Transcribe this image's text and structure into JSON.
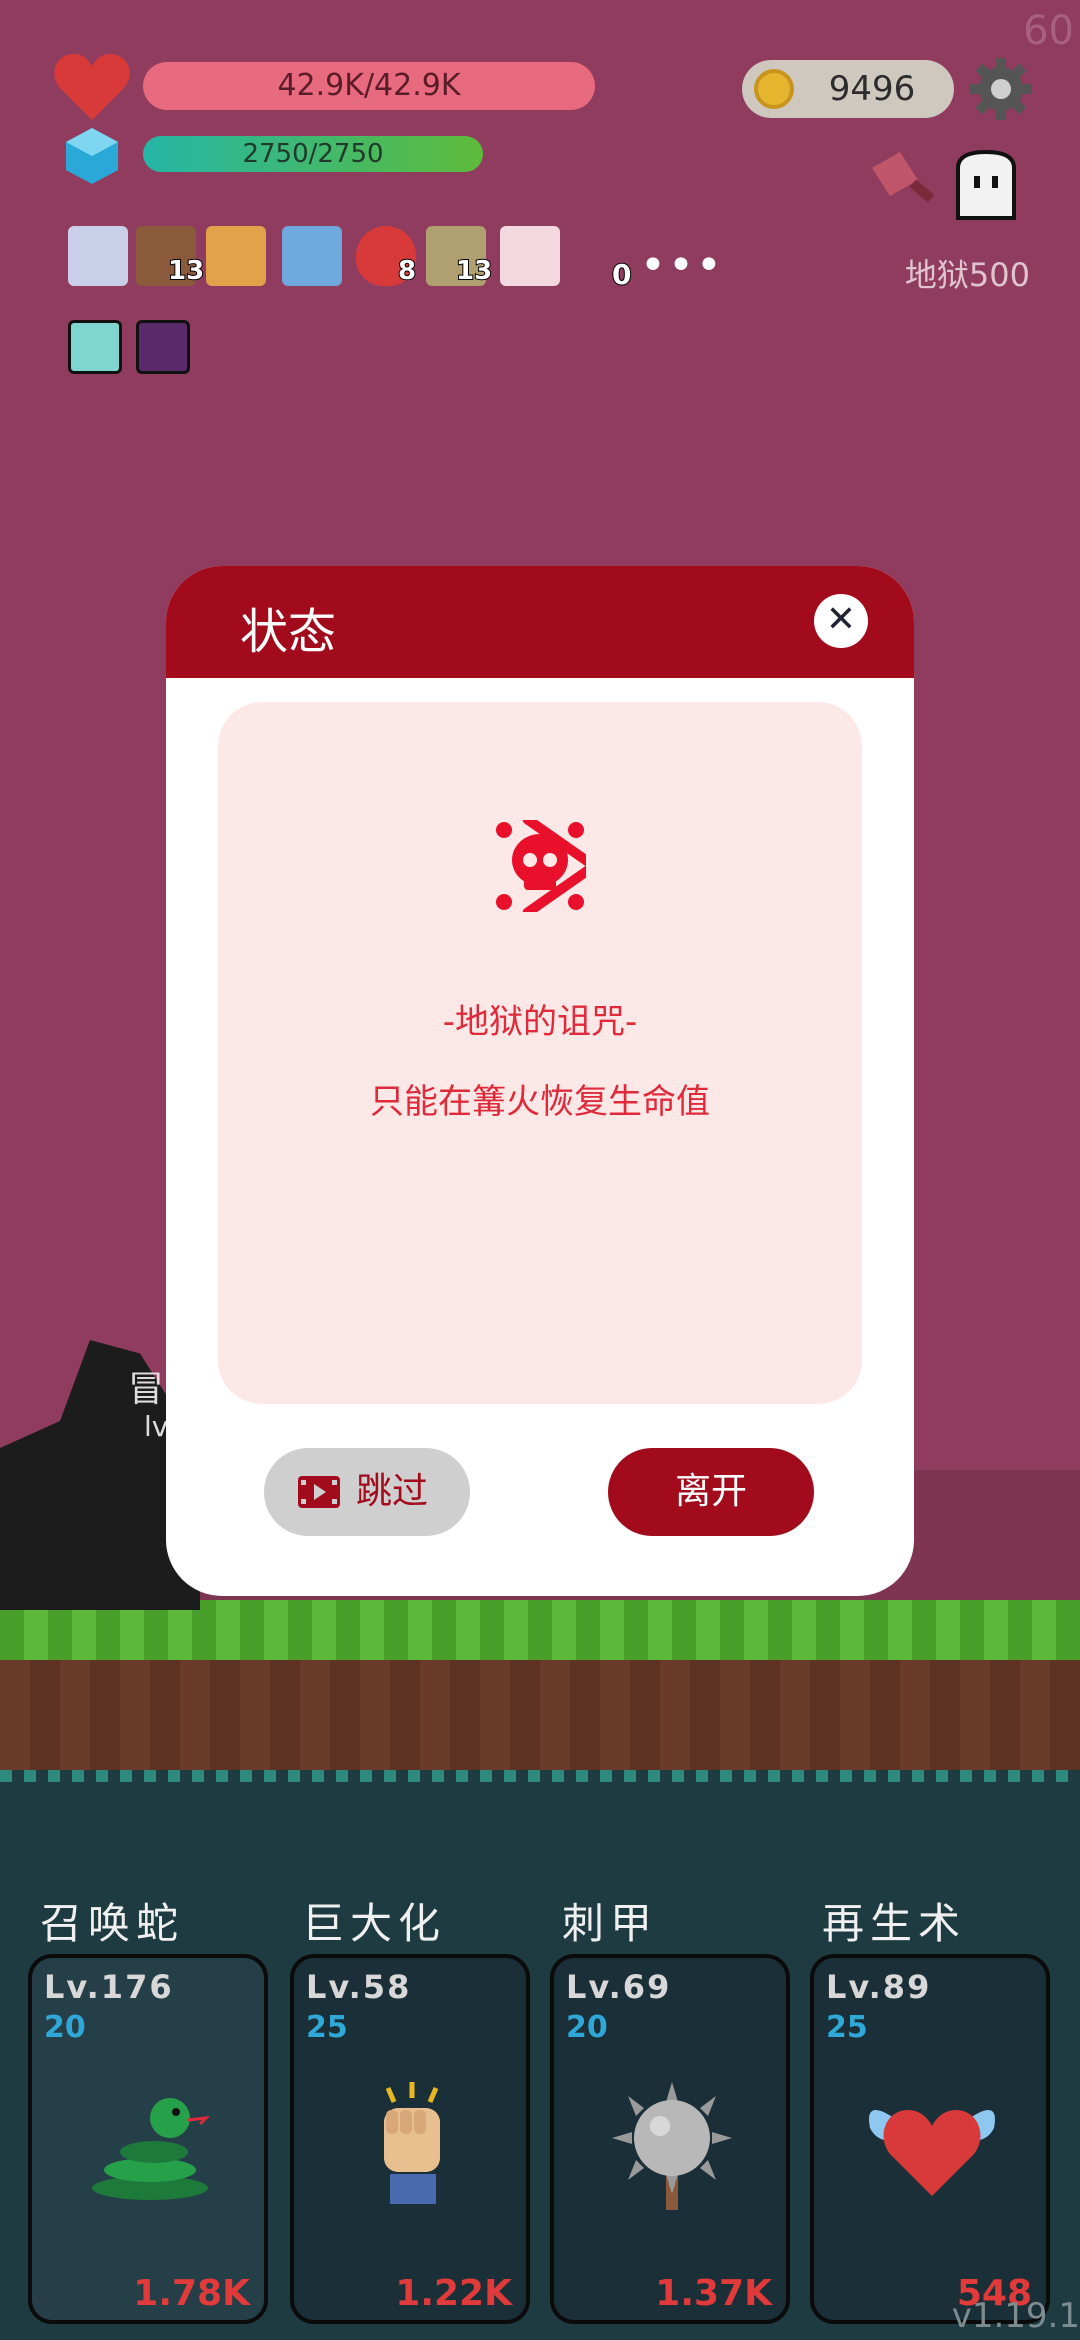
{
  "fps": "60",
  "hud": {
    "hp_text": "42.9K/42.9K",
    "mp_text": "2750/2750",
    "coins": "9496",
    "stage": "地狱500"
  },
  "items": [
    {
      "icon": "flag-badge-icon",
      "count": ""
    },
    {
      "icon": "ship-icon",
      "count": "13"
    },
    {
      "icon": "book-icon",
      "count": ""
    },
    {
      "icon": "shirt-icon",
      "count": ""
    },
    {
      "icon": "strawberry-icon",
      "count": "8"
    },
    {
      "icon": "meteor-icon",
      "count": "13"
    },
    {
      "icon": "calendar-heart-icon",
      "count": ""
    }
  ],
  "more_count": "0",
  "buffs": [
    "lightbulb-icon",
    "demon-icon"
  ],
  "background": {
    "name_fragment": "冒",
    "level_fragment": "lv"
  },
  "modal": {
    "title": "状态",
    "curse_title": "-地狱的诅咒-",
    "curse_desc": "只能在篝火恢复生命值",
    "skip_label": "跳过",
    "leave_label": "离开"
  },
  "skills": [
    {
      "name": "召唤蛇",
      "level": "Lv.176",
      "mana": "20",
      "cost": "1.78K",
      "icon": "snake-icon"
    },
    {
      "name": "巨大化",
      "level": "Lv.58",
      "mana": "25",
      "cost": "1.22K",
      "icon": "fist-icon"
    },
    {
      "name": "刺甲",
      "level": "Lv.69",
      "mana": "20",
      "cost": "1.37K",
      "icon": "spiked-ball-icon"
    },
    {
      "name": "再生术",
      "level": "Lv.89",
      "mana": "25",
      "cost": "548",
      "icon": "winged-heart-icon"
    }
  ],
  "version": "v1.19.1",
  "colors": {
    "sky": "#8f3c5e",
    "modal_header": "#a10b1c",
    "curse_text": "#e02a3a",
    "mana_text": "#2fa8d8",
    "cost_text": "#e03a3a"
  }
}
